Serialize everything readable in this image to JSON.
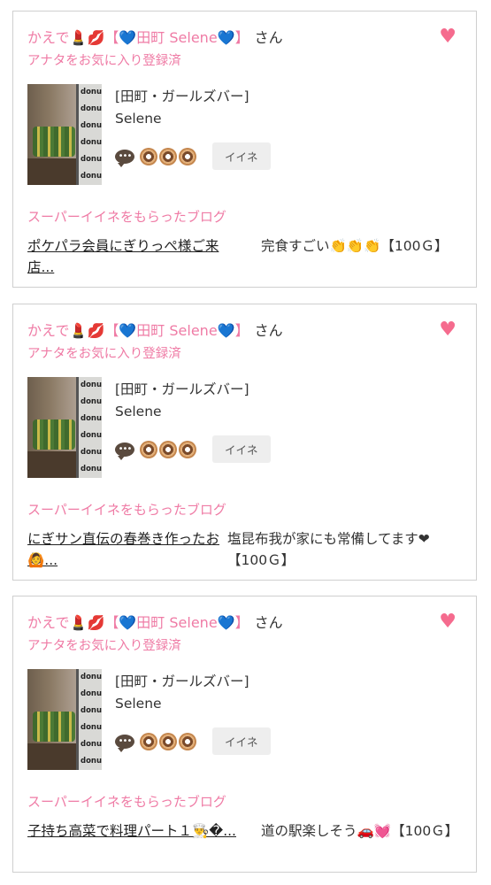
{
  "cards": [
    {
      "name_prefix": "かえで",
      "name_emojis": "💄💋",
      "name_bracket": "【💙田町 Selene💙】",
      "san": "さん",
      "favorite": "アナタをお気に入り登録済",
      "shop": "[田町・ガールズバー]",
      "girl": "Selene",
      "iine_label": "イイネ",
      "super_label": "スーパーイイネをもらったブログ",
      "blog_title": "ポケパラ会員にぎりっぺ様ご来店...",
      "blog_comment": "完食すごい👏👏👏【100Ｇ】"
    },
    {
      "name_prefix": "かえで",
      "name_emojis": "💄💋",
      "name_bracket": "【💙田町 Selene💙】",
      "san": "さん",
      "favorite": "アナタをお気に入り登録済",
      "shop": "[田町・ガールズバー]",
      "girl": "Selene",
      "iine_label": "イイネ",
      "super_label": "スーパーイイネをもらったブログ",
      "blog_title": "にぎサン直伝の春巻き作ったお🙆...",
      "blog_comment": "塩昆布我が家にも常備してます❤【100Ｇ】"
    },
    {
      "name_prefix": "かえで",
      "name_emojis": "💄💋",
      "name_bracket": "【💙田町 Selene💙】",
      "san": "さん",
      "favorite": "アナタをお気に入り登録済",
      "shop": "[田町・ガールズバー]",
      "girl": "Selene",
      "iine_label": "イイネ",
      "super_label": "スーパーイイネをもらったブログ",
      "blog_title": "子持ち高菜で料理パート１👨‍🍳�...",
      "blog_comment": "道の駅楽しそう🚗💓【100Ｇ】"
    }
  ],
  "icons": {
    "heart": "heart-icon",
    "comment": "speech-bubble-icon",
    "rating": "donut-icon"
  },
  "colors": {
    "accent": "#ef7ba5",
    "heart": "#f56b8e",
    "border": "#cfcfcf"
  },
  "photo_text": "donut"
}
